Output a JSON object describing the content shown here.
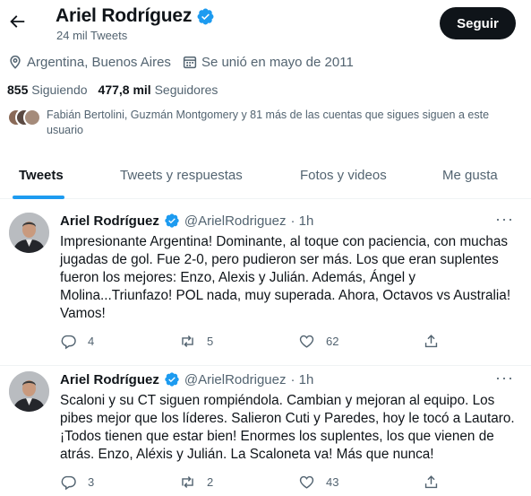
{
  "profile": {
    "name": "Ariel Rodríguez",
    "tweets_count": "24 mil Tweets",
    "follow_label": "Seguir",
    "location": "Argentina, Buenos Aires",
    "joined": "Se unió en mayo de 2011",
    "following_count": "855",
    "following_label": "Siguiendo",
    "followers_count": "477,8 mil",
    "followers_label": "Seguidores",
    "followed_by": "Fabián Bertolini, Guzmán Montgomery y 81 más de las cuentas que sigues siguen a este usuario"
  },
  "tabs": [
    {
      "label": "Tweets",
      "active": true
    },
    {
      "label": "Tweets y respuestas",
      "active": false
    },
    {
      "label": "Fotos y videos",
      "active": false
    },
    {
      "label": "Me gusta",
      "active": false
    }
  ],
  "tweets": [
    {
      "name": "Ariel Rodríguez",
      "handle": "@ArielRodriguez",
      "time": "· 1h",
      "lines": [
        "Impresionante Argentina! Dominante, al toque con paciencia, con muchas",
        "jugadas de gol. Fue 2-0, pero pudieron ser más. Los que eran suplentes",
        "fueron los mejores: Enzo, Alexis y Julián. Además, Ángel y",
        "Molina...Triunfazo! POL nada, muy superada. Ahora, Octavos vs Australia!",
        "Vamos!"
      ],
      "replies": "4",
      "retweets": "5",
      "likes": "62"
    },
    {
      "name": "Ariel Rodríguez",
      "handle": "@ArielRodriguez",
      "time": "· 1h",
      "lines": [
        "Scaloni y su CT siguen rompiéndola. Cambian y mejoran al equipo. Los",
        "pibes mejor que los líderes. Salieron Cuti y Paredes, hoy le tocó a Lautaro.",
        "¡Todos tienen que estar bien! Enormes los suplentes, los que vienen de",
        "atrás. Enzo, Aléxis y Julián. La Scaloneta va! Más que nunca!"
      ],
      "replies": "3",
      "retweets": "2",
      "likes": "43"
    }
  ],
  "colors": {
    "accent": "#1d9bf0",
    "text": "#0f1419",
    "muted": "#536471",
    "button": "#0f1419"
  }
}
